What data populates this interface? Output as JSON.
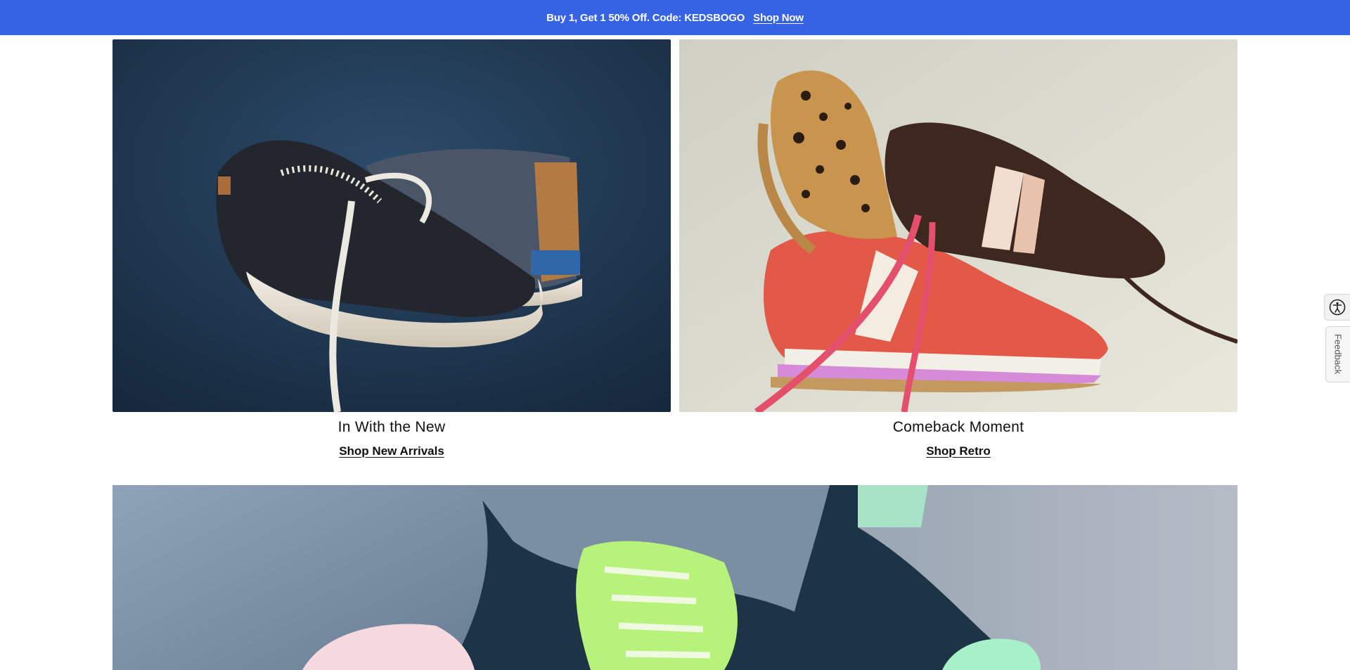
{
  "promo": {
    "text": "Buy 1, Get 1 50% Off. Code: KEDSBOGO",
    "link": "Shop Now"
  },
  "tiles": [
    {
      "heading": "In With the New",
      "cta": "Shop New Arrivals",
      "image": "navy-boat-shoes-photo"
    },
    {
      "heading": "Comeback Moment",
      "cta": "Shop Retro",
      "image": "retro-sneakers-photo"
    }
  ],
  "hero": {
    "image": "denim-sneakers-photo"
  },
  "side_tools": {
    "accessibility_icon": "accessibility-icon",
    "feedback_label": "Feedback"
  }
}
